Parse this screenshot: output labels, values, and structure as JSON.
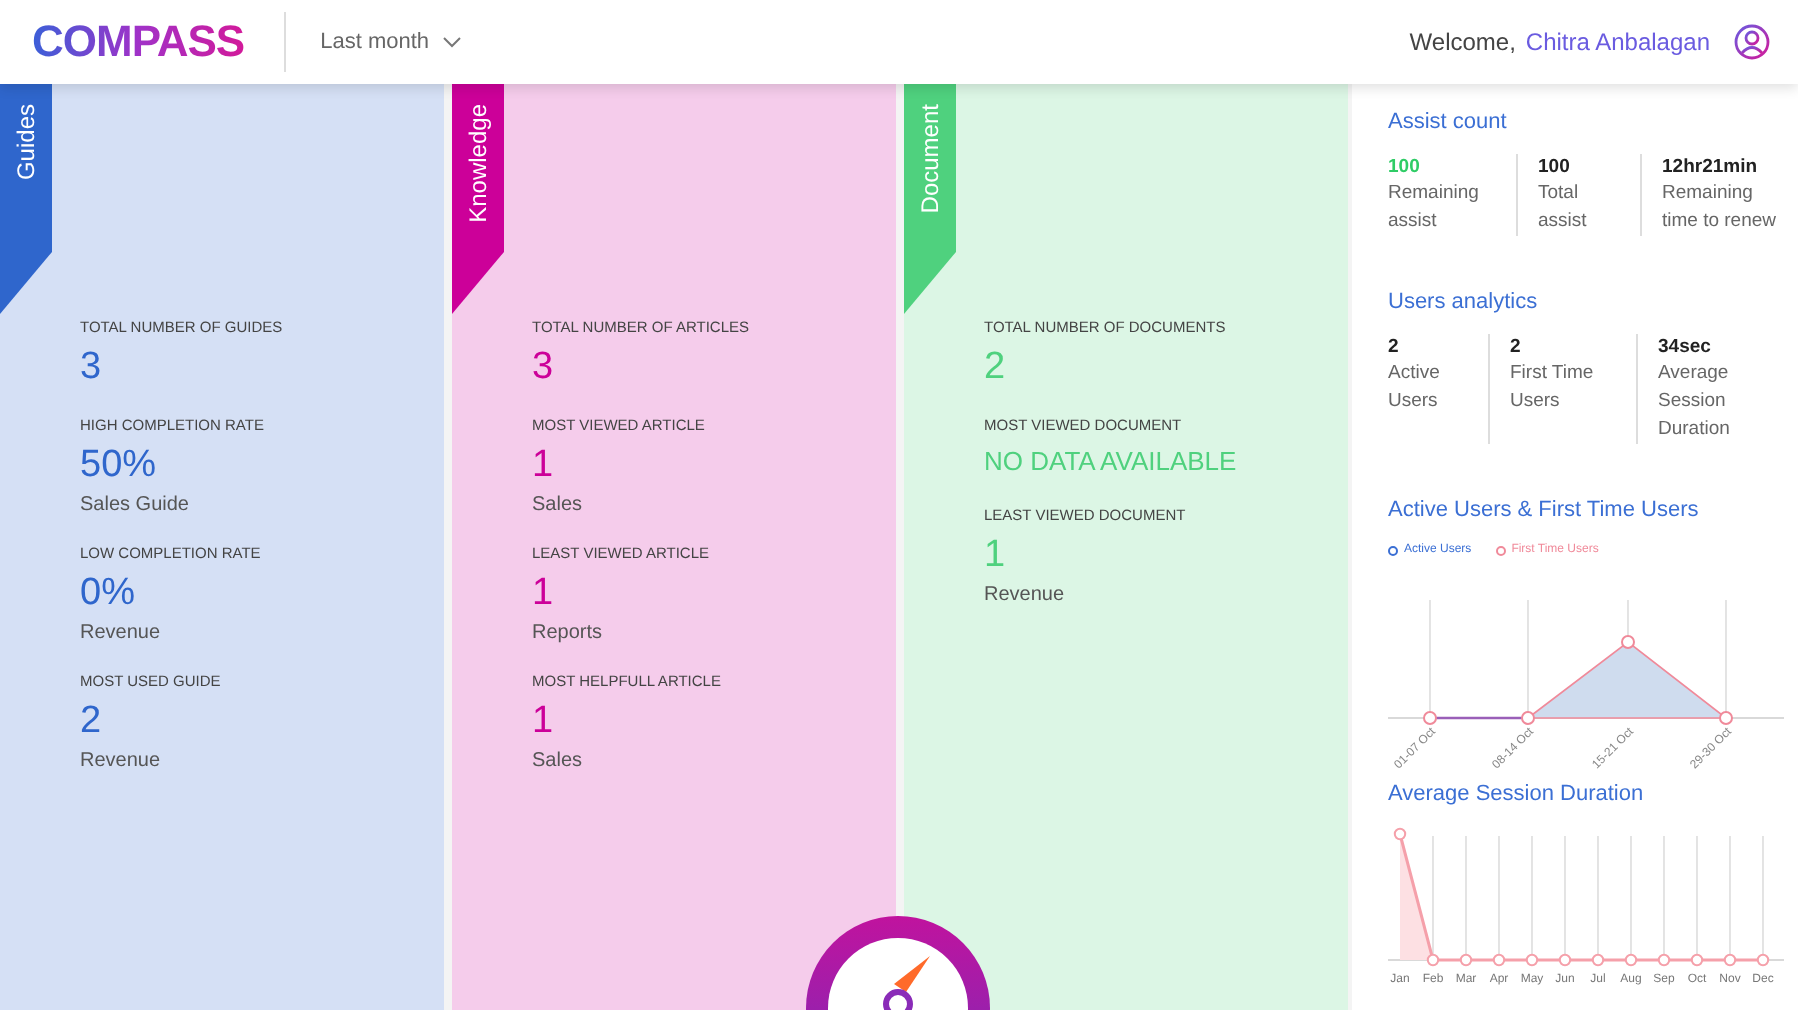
{
  "header": {
    "logo": "COMPASS",
    "period": "Last month",
    "welcome": "Welcome,",
    "user_name": "Chitra Anbalagan"
  },
  "cards": [
    {
      "tab": "Guides",
      "color": "#2f66cc",
      "stats": [
        {
          "label": "TOTAL NUMBER OF GUIDES",
          "value": "3"
        },
        {
          "label": "HIGH COMPLETION RATE",
          "value": "50%",
          "caption": "Sales Guide"
        },
        {
          "label": "LOW COMPLETION RATE",
          "value": "0%",
          "caption": "Revenue"
        },
        {
          "label": "MOST USED GUIDE",
          "value": "2",
          "caption": "Revenue"
        }
      ]
    },
    {
      "tab": "Knowledge",
      "color": "#cc0099",
      "stats": [
        {
          "label": "TOTAL NUMBER OF ARTICLES",
          "value": "3"
        },
        {
          "label": "MOST VIEWED ARTICLE",
          "value": "1",
          "caption": "Sales"
        },
        {
          "label": "LEAST VIEWED ARTICLE",
          "value": "1",
          "caption": "Reports"
        },
        {
          "label": "MOST HELPFULL ARTICLE",
          "value": "1",
          "caption": "Sales"
        }
      ]
    },
    {
      "tab": "Document",
      "color": "#4fd17e",
      "stats": [
        {
          "label": "TOTAL NUMBER OF DOCUMENTS",
          "value": "2"
        },
        {
          "label": "MOST VIEWED DOCUMENT",
          "value": "NO DATA AVAILABLE"
        },
        {
          "label": "LEAST VIEWED DOCUMENT",
          "value": "1",
          "caption": "Revenue"
        }
      ]
    }
  ],
  "assist_count": {
    "title": "Assist count",
    "items": [
      {
        "value": "100",
        "label": "Remaining assist",
        "highlight": true
      },
      {
        "value": "100",
        "label": "Total assist",
        "highlight": false
      },
      {
        "value": "12hr21min",
        "label": "Remaining time to renew",
        "highlight": false
      }
    ]
  },
  "users_analytics": {
    "title": "Users analytics",
    "items": [
      {
        "value": "2",
        "label": "Active Users"
      },
      {
        "value": "2",
        "label": "First Time Users"
      },
      {
        "value": "34sec",
        "label": "Average Session Duration"
      }
    ]
  },
  "users_chart": {
    "title": "Active Users & First Time Users",
    "legend": [
      {
        "name": "Active Users",
        "color": "#3b6fd4"
      },
      {
        "name": "First Time Users",
        "color": "#f08a9a"
      }
    ],
    "x_labels": [
      "01-07 Oct",
      "08-14 Oct",
      "15-21 Oct",
      "29-30 Oct"
    ]
  },
  "session_chart": {
    "title": "Average Session Duration",
    "x_labels": [
      "Jan",
      "Feb",
      "Mar",
      "Apr",
      "May",
      "Jun",
      "Jul",
      "Aug",
      "Sep",
      "Oct",
      "Nov",
      "Dec"
    ]
  }
}
